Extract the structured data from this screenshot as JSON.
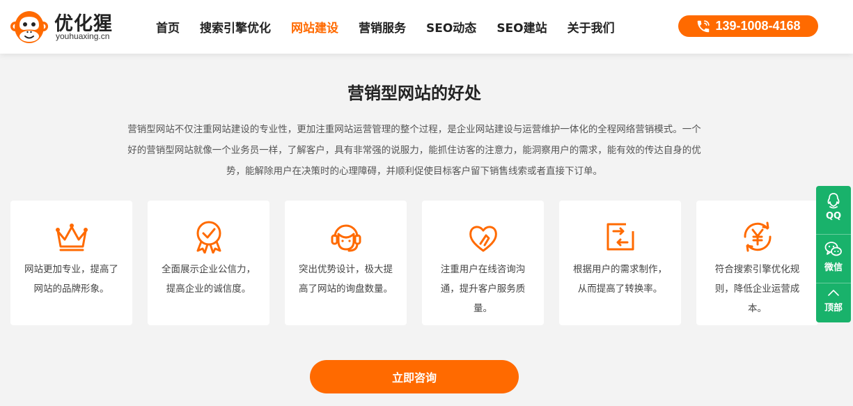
{
  "brand": {
    "name": "优化猩",
    "domain": "youhuaxing.cn",
    "accent": "#ff6a00",
    "side_color": "#19b26b"
  },
  "nav": {
    "items": [
      {
        "label": "首页",
        "active": false
      },
      {
        "label": "搜索引擎优化",
        "active": false
      },
      {
        "label": "网站建设",
        "active": true
      },
      {
        "label": "营销服务",
        "active": false
      },
      {
        "label": "SEO动态",
        "active": false
      },
      {
        "label": "SEO建站",
        "active": false
      },
      {
        "label": "关于我们",
        "active": false
      }
    ]
  },
  "phone": {
    "icon": "phone-icon",
    "number": "139-1008-4168"
  },
  "section": {
    "title": "营销型网站的好处",
    "intro": "营销型网站不仅注重网站建设的专业性，更加注重网站运营管理的整个过程，是企业网站建设与运营维护一体化的全程网络营销模式。一个好的营销型网站就像一个业务员一样，了解客户，具有非常强的说服力，能抓住访客的注意力，能洞察用户的需求，能有效的传达自身的优势，能解除用户在决策时的心理障碍，并顺利促使目标客户留下销售线索或者直接下订单。"
  },
  "cards": [
    {
      "icon": "crown-icon",
      "text": "网站更加专业，提高了网站的品牌形象。"
    },
    {
      "icon": "badge-check-icon",
      "text": "全面展示企业公信力，提高企业的诚信度。"
    },
    {
      "icon": "customer-service-icon",
      "text": "突出优势设计，极大提高了网站的询盘数量。"
    },
    {
      "icon": "heart-hand-icon",
      "text": "注重用户在线咨询沟通，提升客户服务质量。"
    },
    {
      "icon": "transfer-icon",
      "text": "根据用户的需求制作，从而提高了转换率。"
    },
    {
      "icon": "yen-cycle-icon",
      "text": "符合搜索引擎优化规则，降低企业运营成本。"
    }
  ],
  "cta": {
    "label": "立即咨询"
  },
  "side": {
    "qq_label": "QQ",
    "wechat_label": "微信",
    "top_label": "顶部"
  }
}
